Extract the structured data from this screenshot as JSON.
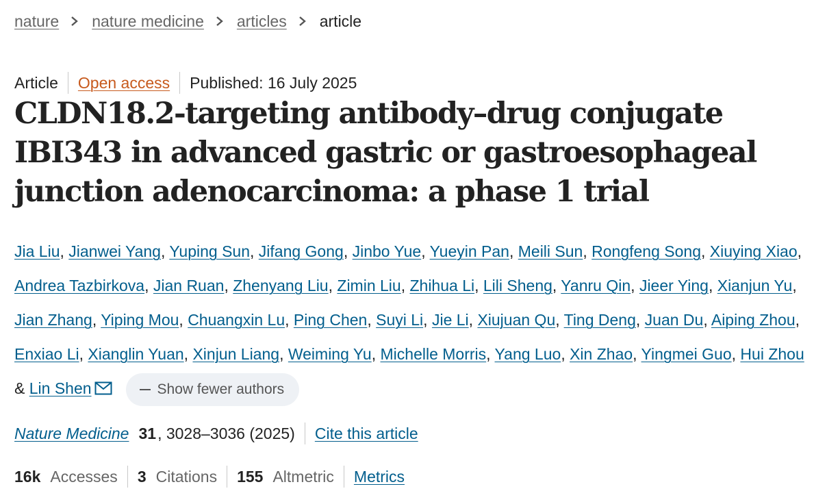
{
  "breadcrumb": {
    "items": [
      "nature",
      "nature medicine",
      "articles"
    ],
    "current": "article"
  },
  "meta": {
    "type": "Article",
    "access": "Open access",
    "published": "Published: 16 July 2025"
  },
  "title": "CLDN18.2-targeting antibody–drug conjugate IBI343 in advanced gastric or gastroesophageal junction adenocarcinoma: a phase 1 trial",
  "authors": [
    "Jia Liu",
    "Jianwei Yang",
    "Yuping Sun",
    "Jifang Gong",
    "Jinbo Yue",
    "Yueyin Pan",
    "Meili Sun",
    "Rongfeng Song",
    "Xiuying Xiao",
    "Andrea Tazbirkova",
    "Jian Ruan",
    "Zhenyang Liu",
    "Zimin Liu",
    "Zhihua Li",
    "Lili Sheng",
    "Yanru Qin",
    "Jieer Ying",
    "Xianjun Yu",
    "Jian Zhang",
    "Yiping Mou",
    "Chuangxin Lu",
    "Ping Chen",
    "Suyi Li",
    "Jie Li",
    "Xiujuan Qu",
    "Ting Deng",
    "Juan Du",
    "Aiping Zhou",
    "Enxiao Li",
    "Xianglin Yuan",
    "Xinjun Liang",
    "Weiming Yu",
    "Michelle Morris",
    "Yang Luo",
    "Xin Zhao",
    "Yingmei Guo",
    "Hui Zhou"
  ],
  "authors_separator": ", ",
  "authors_conjunction": " & ",
  "last_author": "Lin Shen",
  "show_fewer_label": "Show fewer authors",
  "citation": {
    "journal": "Nature Medicine",
    "volume": "31",
    "pages": ", 3028–3036 (2025)",
    "cite_label": "Cite this article"
  },
  "metrics": {
    "accesses_value": "16k",
    "accesses_label": "Accesses",
    "citations_value": "3",
    "citations_label": "Citations",
    "altmetric_value": "155",
    "altmetric_label": "Altmetric",
    "metrics_link": "Metrics"
  },
  "icons": {
    "crumb_separator": "chevron-right-icon",
    "corresponding_author": "mail-icon",
    "show_fewer": "minus-icon"
  },
  "colors": {
    "link": "#025e8d",
    "open_access": "#c75a1d",
    "pill_bg": "#eef1f5"
  }
}
